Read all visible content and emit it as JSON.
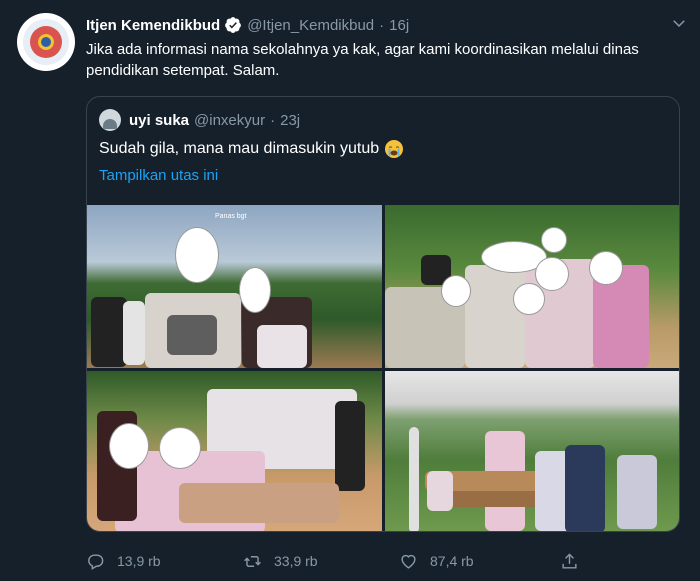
{
  "tweet": {
    "author": {
      "name": "Itjen Kemendikbud",
      "handle": "@Itjen_Kemdikbud",
      "verified": true,
      "avatar_icon": "kemendikbud-logo"
    },
    "separator": "·",
    "time": "16j",
    "text": "Jika ada informasi nama sekolahnya ya kak, agar kami koordinasikan melalui dinas pendidikan setempat. Salam."
  },
  "quoted": {
    "author": {
      "name": "uyi suka",
      "handle": "@inxekyur",
      "avatar_icon": "user-avatar"
    },
    "separator": "·",
    "time": "23j",
    "text": "Sudah gila, mana mau dimasukin yutub",
    "emoji": "loudly-crying-face",
    "thread_link": "Tampilkan utas ini",
    "photo_caption": "Panas bgt"
  },
  "actions": {
    "reply_count": "13,9 rb",
    "retweet_count": "33,9 rb",
    "like_count": "87,4 rb"
  },
  "colors": {
    "background": "#15202b",
    "secondary_text": "#8899a6",
    "link": "#1da1f2",
    "border": "#38444d",
    "verified_badge": "#ffffff"
  }
}
